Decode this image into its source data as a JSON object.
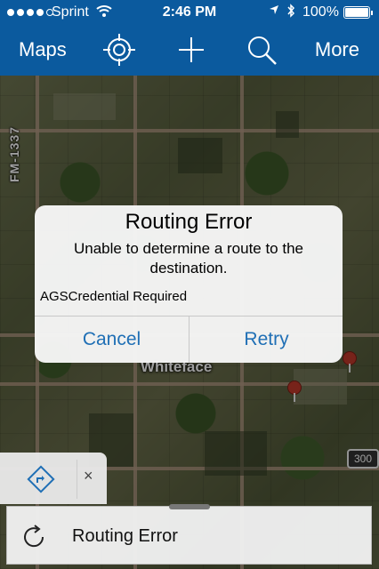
{
  "status_bar": {
    "carrier": "Sprint",
    "time": "2:46 PM",
    "battery": "100%",
    "wifi_icon": "wifi-icon",
    "location_icon": "location-arrow-icon",
    "bluetooth_icon": "bluetooth-icon"
  },
  "nav_bar": {
    "maps_label": "Maps",
    "more_label": "More",
    "icons": [
      "locate-icon",
      "add-icon",
      "search-icon"
    ],
    "color": "#0b5a9e"
  },
  "map": {
    "road_label": "FM-1337",
    "town_label": "Whiteface",
    "highway_shield": "300"
  },
  "alert": {
    "title": "Routing Error",
    "message": "Unable to determine a route to the destination.",
    "detail": "AGSCredential Required",
    "cancel_label": "Cancel",
    "retry_label": "Retry",
    "button_color": "#1f6fb5"
  },
  "bottom_panel": {
    "route_label": "Routing Error",
    "close_glyph": "×"
  }
}
